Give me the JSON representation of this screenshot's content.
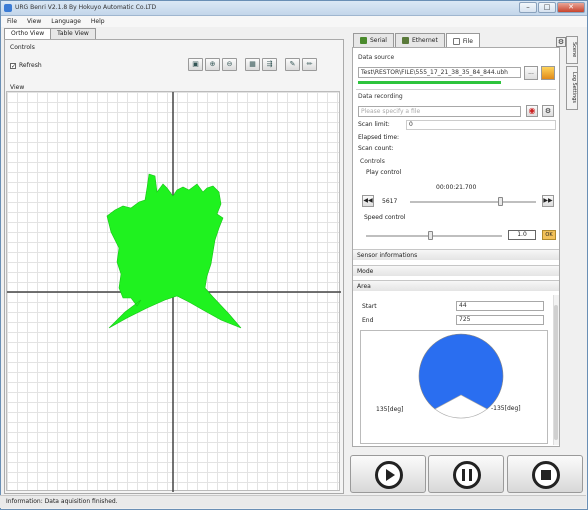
{
  "window": {
    "title": "URG Benri V2.1.8 By Hokuyo Automatic Co.LTD"
  },
  "menu": [
    "File",
    "View",
    "Language",
    "Help"
  ],
  "left_tabs": [
    "Ortho View",
    "Table View"
  ],
  "left": {
    "controls_label": "Controls",
    "refresh_label": "Refresh",
    "view_label": "View"
  },
  "right_tabs": [
    "Serial",
    "Ethernet",
    "File"
  ],
  "side_tabs": [
    "Scene",
    "Log Settings"
  ],
  "data_source": {
    "label": "Data source",
    "path": "Test\\RESTOR\\FILE\\555_17_21_38_35_84_844.ubh"
  },
  "data_recording": {
    "label": "Data recording",
    "placeholder": "Please specify a file"
  },
  "scan": {
    "scan_limit_label": "Scan limit:",
    "scan_limit_value": "0",
    "elapsed_label": "Elapsed time:",
    "scan_count_label": "Scan count:"
  },
  "controls": {
    "label": "Controls",
    "play_control_label": "Play control",
    "time": "00:00:21.700",
    "frame": "5617",
    "speed_control_label": "Speed control",
    "speed_value": "1.0",
    "speed_ok": "OK"
  },
  "sections": [
    "Sensor informations",
    "Mode",
    "Area"
  ],
  "area": {
    "start_label": "Start",
    "start_value": "44",
    "end_label": "End",
    "end_value": "725",
    "left_angle": "135[deg]",
    "right_angle": "-135[deg]"
  },
  "status": "Information: Data aquisition finished.",
  "colors": {
    "scan": "#1ff21f",
    "area_fill": "#2a6ef0",
    "progress": "#2ec43d"
  }
}
